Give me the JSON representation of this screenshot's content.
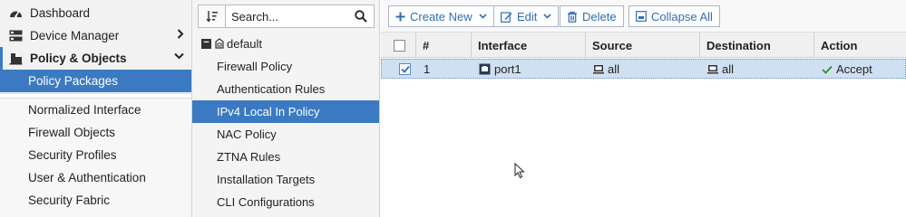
{
  "nav": {
    "items": [
      {
        "label": "Dashboard",
        "icon": "dashboard-icon"
      },
      {
        "label": "Device Manager",
        "icon": "device-manager-icon"
      },
      {
        "label": "Policy & Objects",
        "icon": "policy-objects-icon"
      },
      {
        "label": "Policy Packages"
      },
      {
        "label": "Normalized Interface"
      },
      {
        "label": "Firewall Objects"
      },
      {
        "label": "Security Profiles"
      },
      {
        "label": "User & Authentication"
      },
      {
        "label": "Security Fabric"
      }
    ]
  },
  "tree": {
    "search_placeholder": "Search...",
    "root_label": "default",
    "items": [
      {
        "label": "Firewall Policy"
      },
      {
        "label": "Authentication Rules"
      },
      {
        "label": "IPv4 Local In Policy"
      },
      {
        "label": "NAC Policy"
      },
      {
        "label": "ZTNA Rules"
      },
      {
        "label": "Installation Targets"
      },
      {
        "label": "CLI Configurations"
      }
    ]
  },
  "toolbar": {
    "create_new": "Create New",
    "edit": "Edit",
    "delete": "Delete",
    "collapse_all": "Collapse All"
  },
  "grid": {
    "columns": [
      "#",
      "Interface",
      "Source",
      "Destination",
      "Action"
    ],
    "rows": [
      {
        "seq": "1",
        "interface": "port1",
        "source": "all",
        "destination": "all",
        "action": "Accept"
      }
    ]
  },
  "colors": {
    "accent": "#3b7ac2",
    "row_selected": "#cfe0f3",
    "accept_green": "#2e8b2e"
  }
}
